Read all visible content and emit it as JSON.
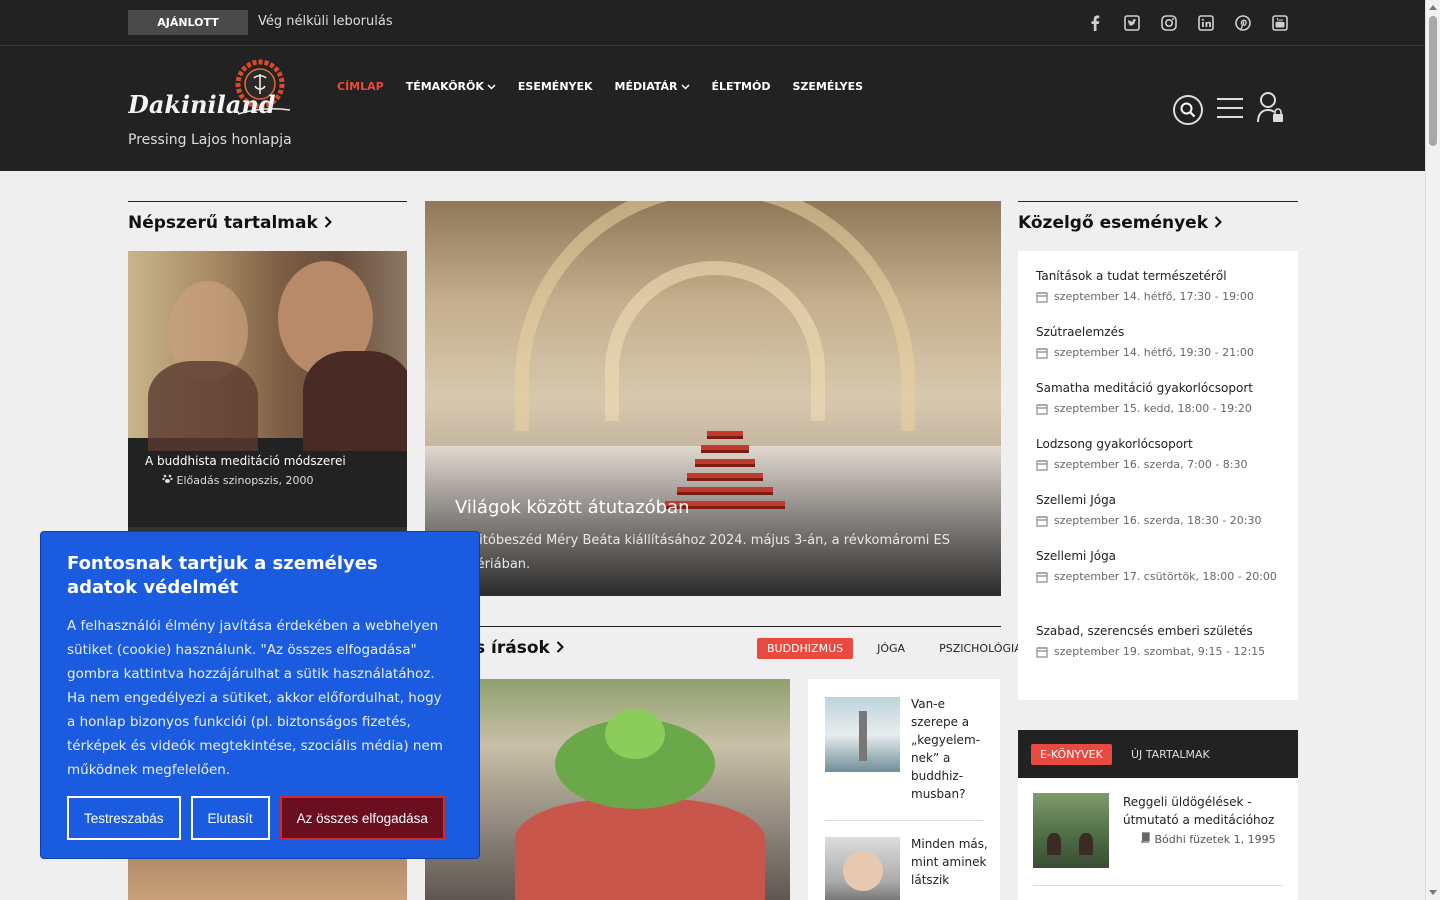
{
  "topbar": {
    "badge": "AJÁNLOTT",
    "featured_title": "Vég nélküli leborulás",
    "social": [
      "facebook-icon",
      "twitter-icon",
      "instagram-icon",
      "linkedin-icon",
      "pinterest-icon",
      "youtube-icon"
    ]
  },
  "header": {
    "logo_text": "Dakiniland",
    "tagline": "Pressing Lajos honlapja",
    "nav": [
      {
        "label": "CÍMLAP",
        "active": true,
        "dropdown": false
      },
      {
        "label": "TÉMAKÖRÖK",
        "active": false,
        "dropdown": true
      },
      {
        "label": "ESEMÉNYEK",
        "active": false,
        "dropdown": false
      },
      {
        "label": "MÉDIATÁR",
        "active": false,
        "dropdown": true
      },
      {
        "label": "ÉLETMÓD",
        "active": false,
        "dropdown": false
      },
      {
        "label": "SZEMÉLYES",
        "active": false,
        "dropdown": false
      }
    ]
  },
  "popular": {
    "heading": "Népszerű tartalmak",
    "item_title": "A buddhista meditáció módszerei",
    "item_meta": "Előadás szinopszis, 2000"
  },
  "hero": {
    "title": "Világok között átutazóban",
    "description": "gnyitóbeszéd Méry Beáta kiállításához 2024. május 3-án, a révkomáromi ES Galériában."
  },
  "writings": {
    "heading_fragment": "s írások",
    "tabs": [
      {
        "label": "BUDDHIZMUS",
        "active": true
      },
      {
        "label": "JÓGA",
        "active": false
      },
      {
        "label": "PSZICHOLÓGIA",
        "active": false
      }
    ],
    "side_items": [
      {
        "text": "Van-e szerepe a „kegyelem-nek” a buddhiz-musban?"
      },
      {
        "text": "Minden más, mint aminek látszik"
      }
    ]
  },
  "events": {
    "heading": "Közelgő események",
    "items": [
      {
        "title": "Tanítások a tudat természetéről",
        "date": "szeptember 14. hétfő, 17:30 - 19:00"
      },
      {
        "title": "Szútraelemzés",
        "date": "szeptember 14. hétfő, 19:30 - 21:00"
      },
      {
        "title": "Samatha meditáció gyakorlócsoport",
        "date": "szeptember 15. kedd, 18:00 - 19:20"
      },
      {
        "title": "Lodzsong gyakorlócsoport",
        "date": "szeptember 16. szerda, 7:00 - 8:30"
      },
      {
        "title": "Szellemi Jóga",
        "date": "szeptember 16. szerda, 18:30 - 20:30"
      },
      {
        "title": "Szellemi Jóga",
        "date": "szeptember 17. csütörtök, 18:00 - 20:00"
      },
      {
        "title": "Szabad, szerencsés emberi születés",
        "date": "szeptember 19. szombat, 9:15 - 12:15"
      }
    ]
  },
  "ebooks": {
    "tabs": [
      {
        "label": "E-KÖNYVEK",
        "active": true
      },
      {
        "label": "ÚJ TARTALMAK",
        "active": false
      }
    ],
    "item_title": "Reggeli üldögélések - útmutató a meditációhoz",
    "item_meta": "Bódhi füzetek 1, 1995"
  },
  "cookie": {
    "title": "Fontosnak tartjuk a személyes adatok védelmét",
    "text": "A felhasználói élmény javítása érdekében a webhelyen sütiket (cookie) használunk. \"Az összes elfogadása\" gombra kattintva hozzájárulhat a sütik használatához. Ha nem engedélyezi a sütiket, akkor előfordulhat, hogy a honlap bizonyos funkciói (pl. biztonságos fizetés, térképek és videók megtekintése, szociális média) nem működnek megfelelően.",
    "btn_customize": "Testreszabás",
    "btn_reject": "Elutasít",
    "btn_accept": "Az összes elfogadása"
  },
  "colors": {
    "accent": "#e84a3f",
    "dark": "#222222",
    "cookie_bg": "#1a5be0",
    "accept_btn": "#6b0f20"
  }
}
